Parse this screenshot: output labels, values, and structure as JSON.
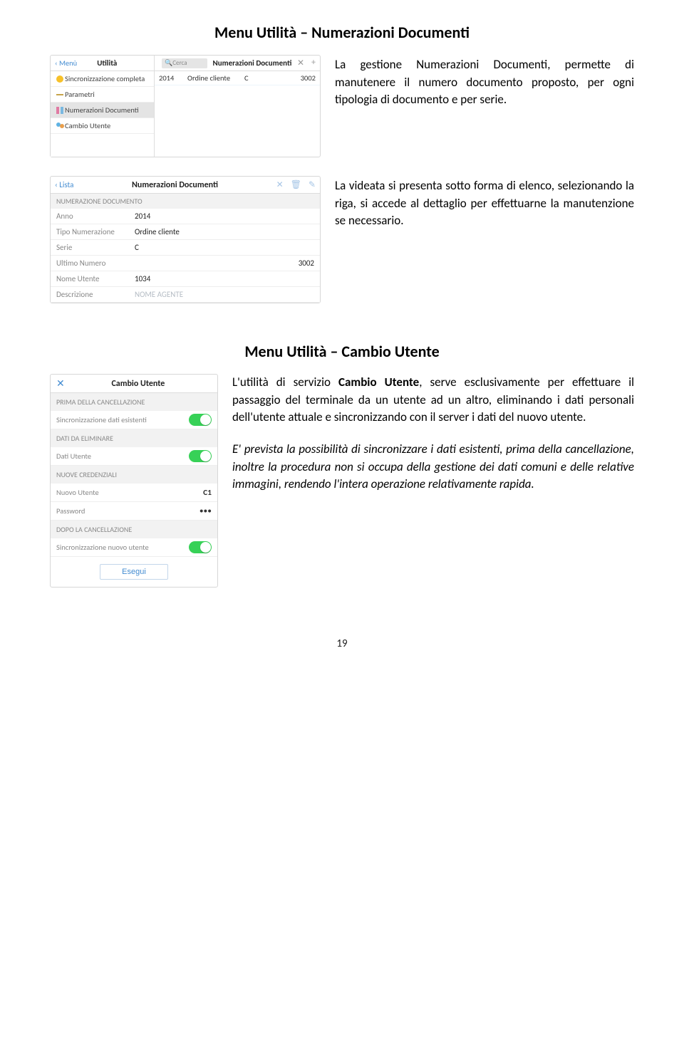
{
  "section1": {
    "title": "Menu Utilità – Numerazioni Documenti"
  },
  "shot1": {
    "menu_link": "Menù",
    "left_title": "Utilità",
    "search_placeholder": "Cerca",
    "right_title": "Numerazioni Documenti",
    "close_glyph": "✕",
    "plus_glyph": "+",
    "sidebar": [
      {
        "label": "Sincronizzazione completa"
      },
      {
        "label": "Parametri"
      },
      {
        "label": "Numerazioni Documenti"
      },
      {
        "label": "Cambio Utente"
      }
    ],
    "row": {
      "c1": "2014",
      "c2": "Ordine cliente",
      "c3": "C",
      "c4": "3002"
    }
  },
  "para1": "La gestione Numerazioni Documenti, permette di manutenere il numero documento proposto, per ogni tipologia di documento e per serie.",
  "shot2": {
    "back": "Lista",
    "title": "Numerazioni Documenti",
    "icons": {
      "x": "✕",
      "trash": "🗑",
      "edit": "✎"
    },
    "section": "NUMERAZIONE DOCUMENTO",
    "rows": {
      "anno": {
        "lbl": "Anno",
        "val": "2014"
      },
      "tipo": {
        "lbl": "Tipo Numerazione",
        "val": "Ordine cliente"
      },
      "serie": {
        "lbl": "Serie",
        "val": "C"
      },
      "ultimo": {
        "lbl": "Ultimo Numero",
        "val": "3002"
      },
      "nome": {
        "lbl": "Nome Utente",
        "val": "1034"
      },
      "descr": {
        "lbl": "Descrizione",
        "val": "NOME AGENTE"
      }
    }
  },
  "para2": "La videata si presenta sotto forma di elenco, selezionando la riga, si accede al dettaglio per effettuarne la manutenzione se necessario.",
  "section2": {
    "title": "Menu Utilità – Cambio Utente"
  },
  "shot3": {
    "close": "✕",
    "title": "Cambio Utente",
    "sec1": "PRIMA DELLA CANCELLAZIONE",
    "r1": "Sincronizzazione dati esistenti",
    "sec2": "DATI DA ELIMINARE",
    "r2": "Dati Utente",
    "sec3": "NUOVE CREDENZIALI",
    "r3lbl": "Nuovo Utente",
    "r3val": "C1",
    "r4lbl": "Password",
    "r4val": "•••",
    "sec4": "DOPO LA CANCELLAZIONE",
    "r5": "Sincronizzazione nuovo utente",
    "btn": "Esegui"
  },
  "para3a": "L'utilità di servizio ",
  "para3b": "Cambio Utente",
  "para3c": ", serve esclusivamente per effettuare il passaggio del terminale da un utente ad un altro, eliminando i dati personali dell'utente attuale e sincronizzando con il server i dati del nuovo utente.",
  "para4": "E' prevista la possibilità di sincronizzare i dati esistenti, prima della cancellazione, inoltre la procedura non si occupa della gestione dei dati comuni e delle relative immagini, rendendo l'intera operazione relativamente rapida.",
  "pagenum": "19"
}
